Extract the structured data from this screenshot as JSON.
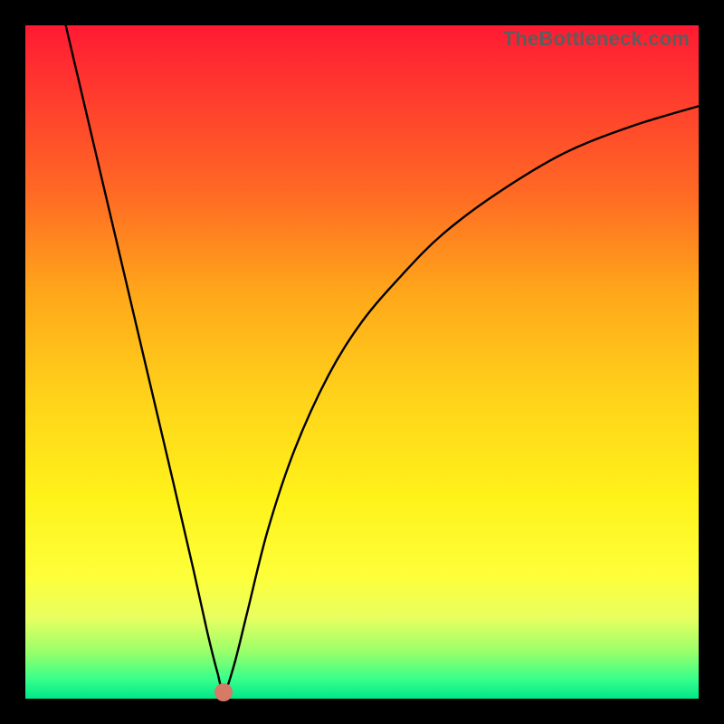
{
  "watermark": "TheBottleneck.com",
  "chart_data": {
    "type": "line",
    "title": "",
    "xlabel": "",
    "ylabel": "",
    "xlim": [
      0,
      100
    ],
    "ylim": [
      0,
      100
    ],
    "annotations": [],
    "gradient_meaning": "vertical color scale from red (high) through yellow to green (low)",
    "marker": {
      "x": 29.5,
      "y": 1.0,
      "color": "#d47a66"
    },
    "series": [
      {
        "name": "curve",
        "x": [
          6,
          10,
          14,
          18,
          22,
          25,
          27,
          28.5,
          29.5,
          31,
          33,
          36,
          40,
          45,
          50,
          56,
          62,
          70,
          80,
          90,
          100
        ],
        "y": [
          100,
          83,
          66,
          49,
          32,
          19,
          10,
          4,
          1,
          5,
          13,
          25,
          37,
          48,
          56,
          63,
          69,
          75,
          81,
          85,
          88
        ]
      }
    ]
  }
}
